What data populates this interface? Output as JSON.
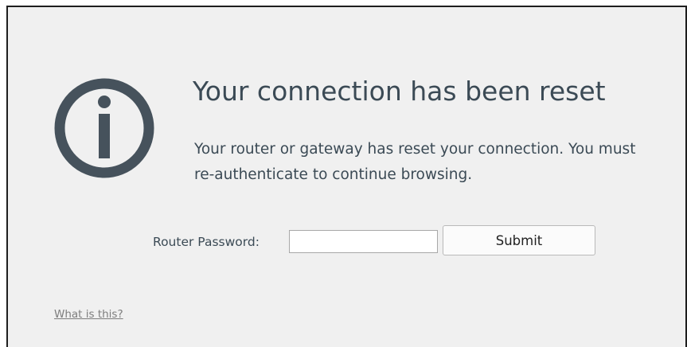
{
  "error_page": {
    "icon": "info-circle-icon",
    "title": "Your connection has been reset",
    "message": "Your router or gateway has reset your connection. You must re-authenticate to continue browsing."
  },
  "auth_form": {
    "password_label": "Router Password:",
    "password_value": "",
    "submit_label": "Submit"
  },
  "help_link": {
    "label": "What is this?"
  },
  "colors": {
    "panel_background": "#f0f0f0",
    "text": "#3b4a55",
    "icon": "#46525c",
    "link": "#7d7d7d",
    "panel_border": "#1e1e1e"
  }
}
